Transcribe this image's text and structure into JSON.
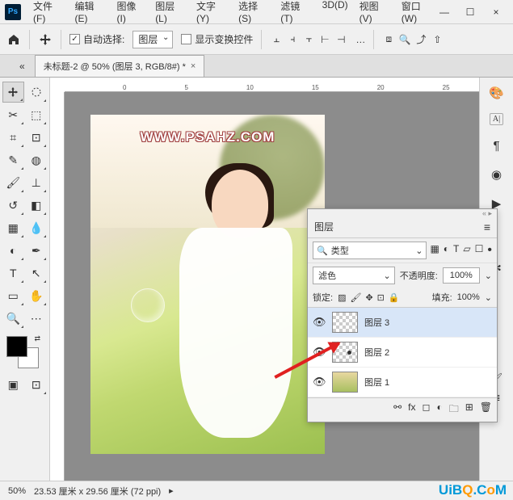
{
  "app": {
    "logo": "Ps"
  },
  "menu": [
    "文件(F)",
    "编辑(E)",
    "图像(I)",
    "图层(L)",
    "文字(Y)",
    "选择(S)",
    "滤镜(T)",
    "3D(D)",
    "视图(V)",
    "窗口(W)"
  ],
  "window_controls": {
    "min": "—",
    "max": "☐",
    "close": "×"
  },
  "options": {
    "auto_select_label": "自动选择:",
    "auto_select_value": "图层",
    "show_transform_label": "显示变换控件",
    "dots": "…"
  },
  "doc_tab": {
    "title": "未标题-2 @ 50% (图层 3, RGB/8#) *",
    "close": "×"
  },
  "ruler_h": [
    "0",
    "5",
    "10",
    "15",
    "20",
    "25"
  ],
  "canvas": {
    "watermark_text": "WWW.PSAHZ.COM"
  },
  "layers_panel": {
    "title": "图层",
    "type_search": "类型",
    "blend_mode": "滤色",
    "opacity_label": "不透明度:",
    "opacity_value": "100%",
    "lock_label": "锁定:",
    "fill_label": "填充:",
    "fill_value": "100%",
    "items": [
      {
        "name": "图层 3",
        "selected": true,
        "thumb": "transparent"
      },
      {
        "name": "图层 2",
        "selected": false,
        "thumb": "transparent-dot"
      },
      {
        "name": "图层 1",
        "selected": false,
        "thumb": "photo"
      }
    ]
  },
  "status": {
    "zoom": "50%",
    "doc_size": "23.53 厘米 x 29.56 厘米 (72 ppi)",
    "arrow": "▸"
  },
  "footer_logo": {
    "pre": "UiB",
    "mid": "Q",
    "post": ".C",
    "mid2": "o",
    "post2": "M"
  }
}
